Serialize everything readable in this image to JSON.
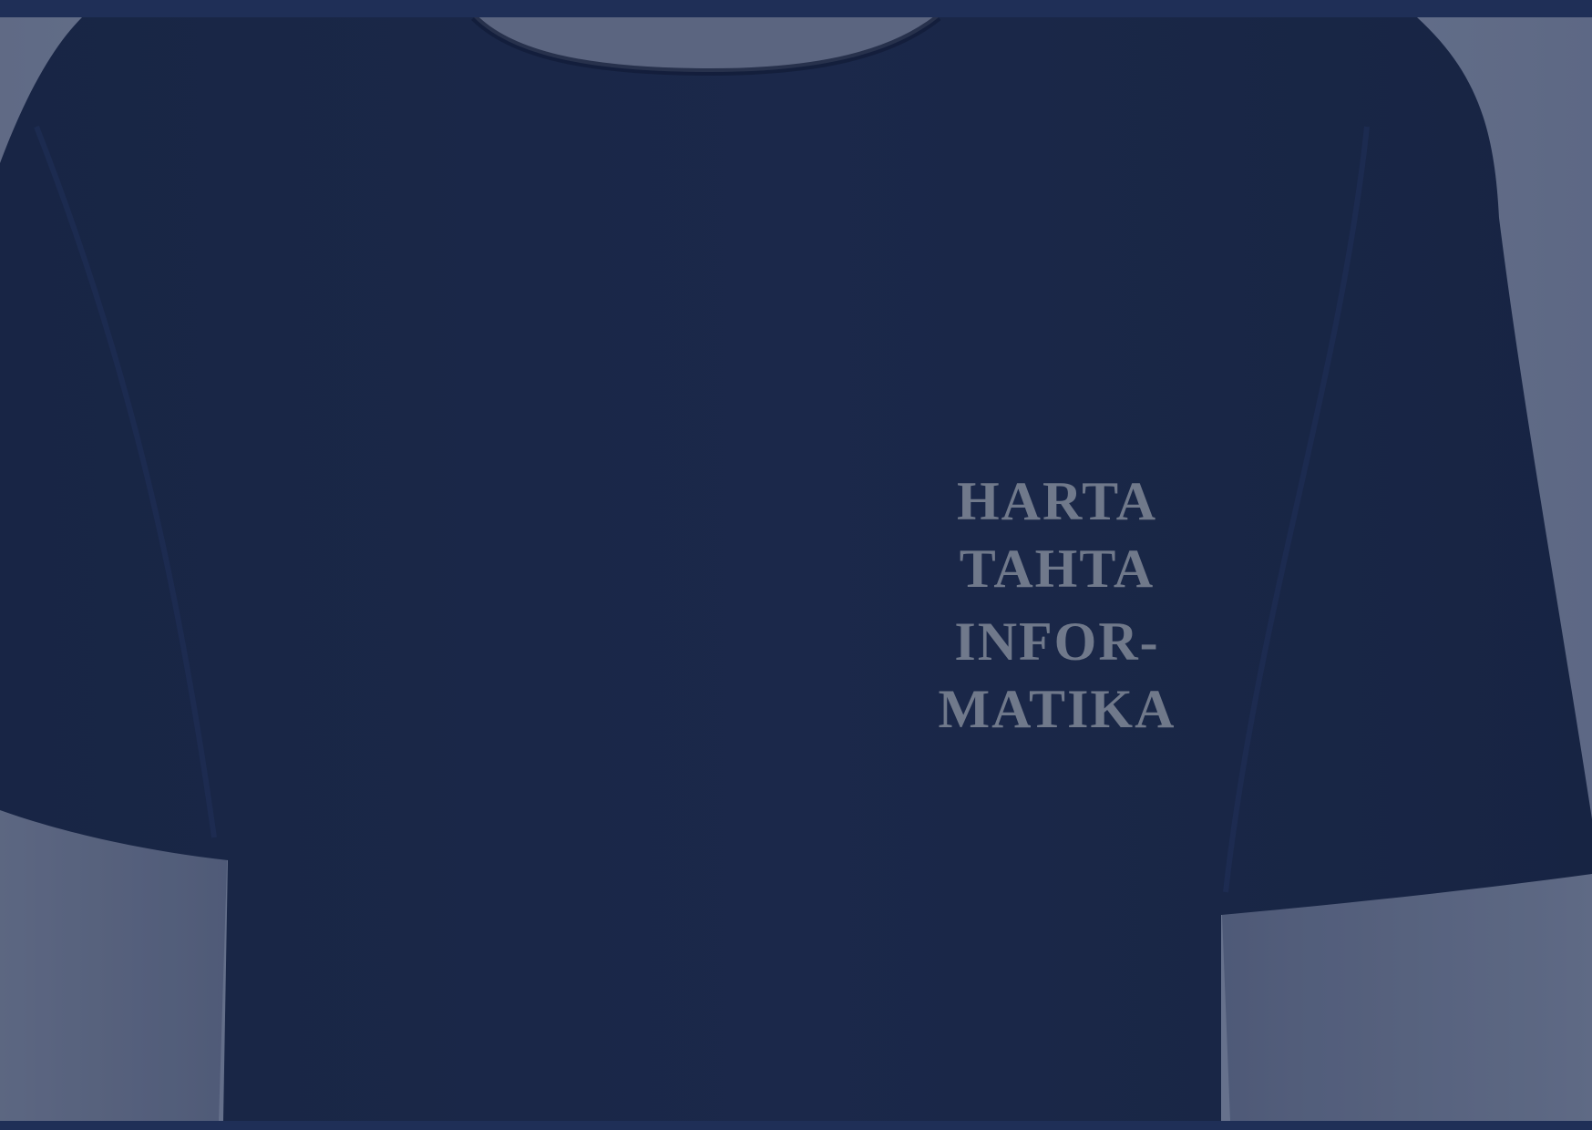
{
  "photo": {
    "shirt_print_lines": [
      "HARTA",
      "TAHTA",
      "INFOR-",
      "MATIKA"
    ]
  },
  "colors": {
    "frame": "#1f2f57",
    "shirt": "#1a2746",
    "print": "#8f95a1",
    "background": "#7c859c"
  }
}
